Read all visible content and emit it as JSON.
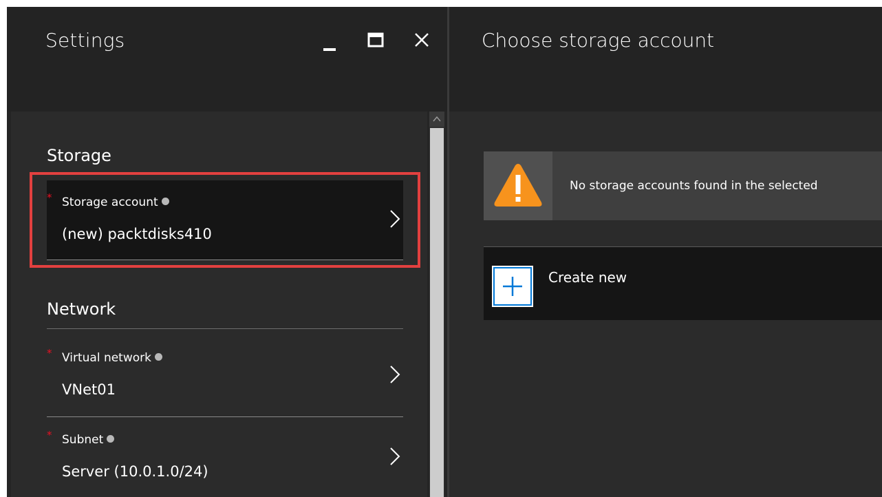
{
  "settings_blade": {
    "title": "Settings",
    "sections": [
      {
        "heading": "Storage",
        "fields": [
          {
            "label": "Storage account",
            "required": true,
            "value": "(new) packtdisks410"
          }
        ]
      },
      {
        "heading": "Network",
        "fields": [
          {
            "label": "Virtual network",
            "required": true,
            "value": "VNet01"
          },
          {
            "label": "Subnet",
            "required": true,
            "value": "Server (10.0.1.0/24)"
          }
        ]
      }
    ],
    "required_marker": "*"
  },
  "storage_blade": {
    "title": "Choose storage account",
    "warning_text": "No storage accounts found in the selected",
    "create_label": "Create new"
  },
  "colors": {
    "highlight": "#e2403f",
    "required": "#e81123",
    "warning": "#f7931d",
    "accent": "#0078d7"
  },
  "icons": [
    "minimize-icon",
    "maximize-icon",
    "close-icon",
    "info-icon",
    "chevron-right-icon",
    "warning-icon",
    "plus-icon",
    "scroll-up-icon"
  ]
}
